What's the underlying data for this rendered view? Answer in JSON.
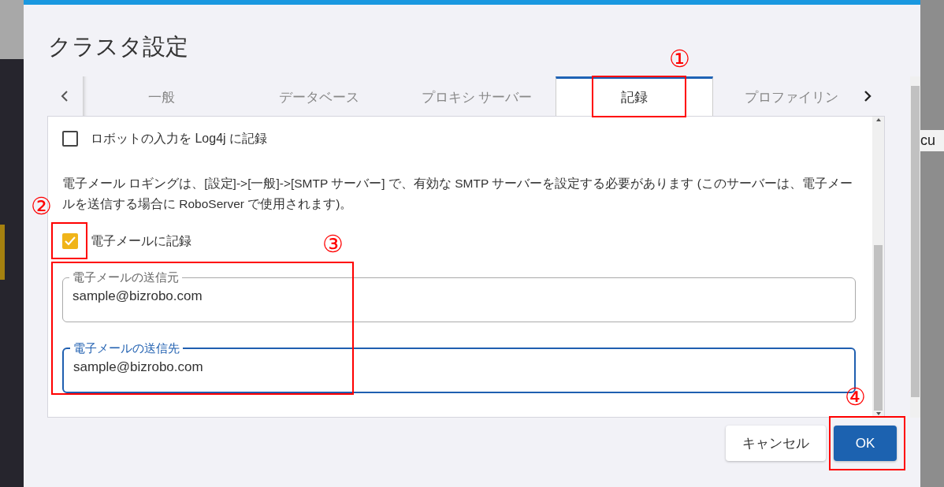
{
  "background_fragment": "cu",
  "dialog": {
    "title": "クラスタ設定",
    "tabs": [
      {
        "label": "一般",
        "selected": false
      },
      {
        "label": "データベース",
        "selected": false
      },
      {
        "label": "プロキシ サーバー",
        "selected": false
      },
      {
        "label": "記録",
        "selected": true,
        "callout": "①"
      },
      {
        "label": "プロファイリン",
        "selected": false
      }
    ],
    "options": [
      {
        "kind": "checkbox",
        "label": "ロボットの入力を Log4j に記録",
        "checked": false
      },
      {
        "kind": "note",
        "text": "電子メール ロギングは、[設定]->[一般]->[SMTP サーバー] で、有効な SMTP サーバーを設定する必要があります (このサーバーは、電子メールを送信する場合に RoboServer で使用されます)。"
      },
      {
        "kind": "checkbox",
        "label": "電子メールに記録",
        "checked": true,
        "callout": "②"
      }
    ],
    "fields_callout": "③",
    "fields": [
      {
        "label": "電子メールの送信元",
        "value": "sample@bizrobo.com",
        "focused": false
      },
      {
        "label": "電子メールの送信先",
        "value": "sample@bizrobo.com",
        "focused": true
      }
    ],
    "buttons": [
      {
        "label": "キャンセル",
        "kind": "secondary"
      },
      {
        "label": "OK",
        "kind": "primary",
        "callout": "④"
      }
    ]
  }
}
